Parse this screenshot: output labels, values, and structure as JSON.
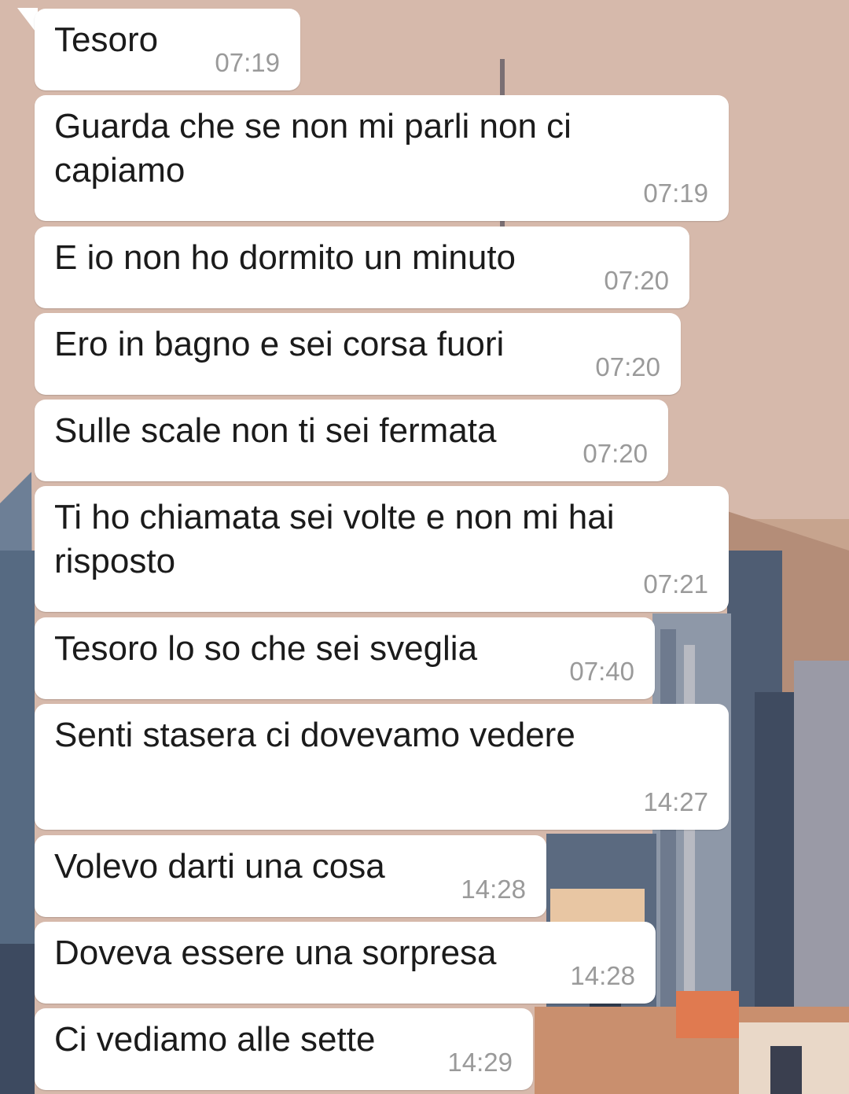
{
  "chat": {
    "messages": [
      {
        "text": "Tesoro",
        "time": "07:19"
      },
      {
        "text": "Guarda che se non mi parli non ci\ncapiamo",
        "time": "07:19"
      },
      {
        "text": "E io non ho dormito un minuto",
        "time": "07:20"
      },
      {
        "text": "Ero in bagno e sei corsa fuori",
        "time": "07:20"
      },
      {
        "text": "Sulle scale non ti sei fermata",
        "time": "07:20"
      },
      {
        "text": "Ti ho chiamata sei volte e non mi hai\nrisposto",
        "time": "07:21"
      },
      {
        "text": "Tesoro lo so che sei sveglia",
        "time": "07:40"
      },
      {
        "text": "Senti stasera ci dovevamo vedere",
        "time": "14:27"
      },
      {
        "text": "Volevo darti una cosa",
        "time": "14:28"
      },
      {
        "text": "Doveva essere una sorpresa",
        "time": "14:28"
      },
      {
        "text": "Ci vediamo alle sette",
        "time": "14:29"
      }
    ]
  },
  "colors": {
    "wallpaper_sky": "#d6b9ab",
    "bubble": "#ffffff",
    "message_text": "#1b1b1b",
    "timestamp": "#9a9a9a"
  }
}
